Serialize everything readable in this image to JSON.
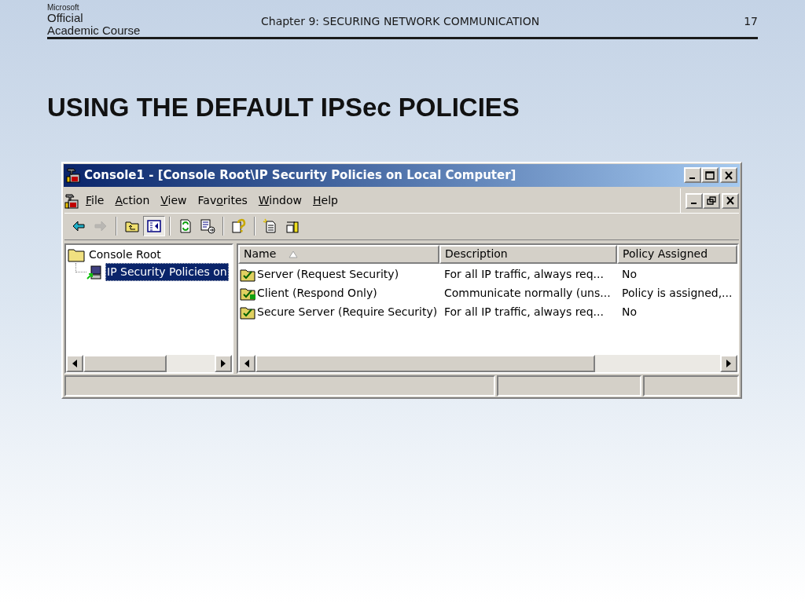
{
  "header": {
    "logo": [
      "Microsoft",
      "Official",
      "Academic Course"
    ],
    "chapter": "Chapter 9: SECURING NETWORK COMMUNICATION",
    "page": "17"
  },
  "title": "USING THE DEFAULT IPSec POLICIES",
  "window": {
    "title": "Console1 - [Console Root\\IP Security Policies on Local Computer]",
    "menu": [
      {
        "key": "F",
        "after": "ile"
      },
      {
        "key": "A",
        "after": "ction"
      },
      {
        "key": "V",
        "after": "iew"
      },
      {
        "before": "Fav",
        "key": "o",
        "after": "rites"
      },
      {
        "key": "W",
        "after": "indow"
      },
      {
        "key": "H",
        "after": "elp"
      }
    ],
    "toolbar": [
      {
        "kind": "back",
        "disabled": false,
        "pressed": false
      },
      {
        "kind": "forward",
        "disabled": true,
        "pressed": false
      },
      {
        "kind": "separator"
      },
      {
        "kind": "up",
        "disabled": false,
        "pressed": false
      },
      {
        "kind": "tree",
        "disabled": false,
        "pressed": true
      },
      {
        "kind": "separator"
      },
      {
        "kind": "refresh",
        "disabled": false,
        "pressed": false
      },
      {
        "kind": "export",
        "disabled": false,
        "pressed": false
      },
      {
        "kind": "separator"
      },
      {
        "kind": "help",
        "disabled": false,
        "pressed": false
      },
      {
        "kind": "separator"
      },
      {
        "kind": "new",
        "disabled": false,
        "pressed": false
      },
      {
        "kind": "manage",
        "disabled": false,
        "pressed": false
      }
    ],
    "tree": [
      {
        "label": "Console Root",
        "selected": false,
        "expanded": true,
        "children": [
          {
            "label": "IP Security Policies on",
            "selected": true
          }
        ]
      }
    ],
    "columns": [
      {
        "label": "Name",
        "sorted": true
      },
      {
        "label": "Description",
        "sorted": false
      },
      {
        "label": "Policy Assigned",
        "sorted": false
      }
    ],
    "rows": [
      {
        "name": "Server (Request Security)",
        "description": "For all IP traffic, always req...",
        "assigned_text": "No",
        "assigned": false
      },
      {
        "name": "Client (Respond Only)",
        "description": "Communicate normally (uns...",
        "assigned_text": "Policy is assigned,...",
        "assigned": true
      },
      {
        "name": "Secure Server (Require Security)",
        "description": "For all IP traffic, always req...",
        "assigned_text": "No",
        "assigned": false
      }
    ]
  }
}
